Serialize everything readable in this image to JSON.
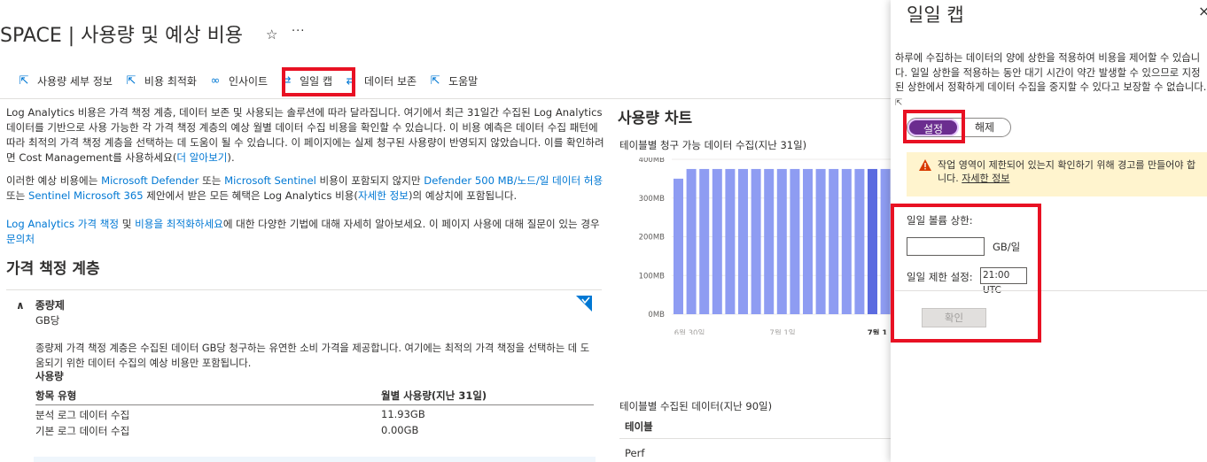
{
  "header": {
    "title": "SPACE | 사용량 및 예상 비용"
  },
  "toolbar": {
    "items": [
      {
        "label": "사용량 세부 정보",
        "icon": "external-link-icon"
      },
      {
        "label": "비용 최적화",
        "icon": "external-link-icon"
      },
      {
        "label": "인사이트",
        "icon": "link-icon"
      },
      {
        "label": "일일 캡",
        "icon": "sync-arrows-icon"
      },
      {
        "label": "데이터 보존",
        "icon": "sync-arrows-icon"
      },
      {
        "label": "도움말",
        "icon": "external-link-icon"
      }
    ]
  },
  "intro": {
    "p1_a": "Log Analytics 비용은 가격 책정 계층, 데이터 보존 및 사용되는 솔루션에 따라 달라집니다. 여기에서 최근 31일간 수집된 Log Analytics 데이터를 기반으로 사용 가능한 각 가격 책정 계층의 예상 월별 데이터 수집 비용을 확인할 수 있습니다. 이 비용 예측은 데이터 수집 패턴에 따라 최적의 가격 책정 계층을 선택하는 데 도움이 될 수 있습니다. 이 페이지에는 실제 청구된 사용량이 반영되지 않았습니다. 이를 확인하려면 Cost Management를 사용하세요(",
    "p1_link": "더 알아보기",
    "p1_b": ").",
    "p2_a": "이러한 예상 비용에는 ",
    "p2_link1": "Microsoft Defender",
    "p2_b": " 또는 ",
    "p2_link2": "Microsoft Sentinel",
    "p2_c": " 비용이 포함되지 않지만 ",
    "p2_link3": "Defender 500 MB/노드/일 데이터 허용",
    "p2_d": " 또는 ",
    "p2_link4": "Sentinel Microsoft 365",
    "p2_e": " 제안에서 받은 모든 혜택은 Log Analytics 비용(",
    "p2_link5": "자세한 정보",
    "p2_f": ")의 예상치에 포함됩니다.",
    "p3_link1": "Log Analytics 가격 책정",
    "p3_a": " 및 ",
    "p3_link2": "비용을 최적화하세요",
    "p3_b": "에 대한 다양한 기법에 대해 자세히 알아보세요. 이 페이지 사용에 대해 질문이 있는 경우 ",
    "p3_link3": "문의처"
  },
  "pricing": {
    "heading": "가격 책정 계층",
    "tier_name": "종량제",
    "tier_unit": "GB당",
    "tier_desc": "종량제 가격 책정 계층은 수집된 데이터 GB당 청구하는 유연한 소비 가격을 제공합니다. 여기에는 최적의 가격 책정을 선택하는 데 도움되기 위한 데이터 수집의 예상 비용만 포함됩니다.",
    "usage_label": "사용량",
    "col1": "항목 유형",
    "col2": "월별 사용량(지난 31일)",
    "rows": [
      {
        "type": "분석 로그 데이터 수집",
        "value": "11.93GB"
      },
      {
        "type": "기본 로그 데이터 수집",
        "value": "0.00GB"
      }
    ]
  },
  "usage_chart": {
    "heading": "사용량 차트",
    "subtitle": "테이블별 청구 가능 데이터 수집(지난 31일)",
    "table_heading": "테이블별 수집된 데이터(지난 90일)",
    "table_col": "테이블",
    "table_row1": "Perf"
  },
  "chart_data": {
    "type": "bar",
    "title": "테이블별 청구 가능 데이터 수집(지난 31일)",
    "yticks": [
      "400MB",
      "300MB",
      "200MB",
      "100MB",
      "0MB"
    ],
    "xticks": [
      "6월 30일",
      "7월 1일",
      "7월 1"
    ],
    "ylim": [
      0,
      400
    ],
    "values": [
      350,
      375,
      375,
      375,
      375,
      375,
      375,
      375,
      375,
      375,
      375,
      375,
      375,
      375,
      375,
      375,
      375
    ],
    "highlight_index": 15,
    "colors": {
      "bar": "#8e9cf2",
      "highlight": "#5b6be0"
    }
  },
  "panel": {
    "title": "일일 캡",
    "desc": "하루에 수집하는 데이터의 양에 상한을 적용하여 비용을 제어할 수 있습니다. 일일 상한을 적용하는 동안 대기 시간이 약간 발생할 수 있으므로 지정된 상한에서 정확하게 데이터 수집을 중지할 수 있다고 보장할 수 없습니다.",
    "toggle_on": "설정",
    "toggle_off": "해제",
    "warning_text": "작업 영역이 제한되어 있는지 확인하기 위해 경고를 만들어야 합니다. ",
    "warning_link": "자세한 정보",
    "cap_label": "일일 볼륨 상한:",
    "cap_value": "",
    "cap_unit": "GB/일",
    "reset_label": "일일 제한 설정:",
    "reset_value": "21:00 UTC",
    "confirm": "확인"
  },
  "colors": {
    "accent": "#0078d4",
    "highlight_box": "#e81123",
    "toggle_on": "#6b2d8f",
    "warning_bg": "#fff4ce",
    "warning_icon": "#d83b01"
  }
}
